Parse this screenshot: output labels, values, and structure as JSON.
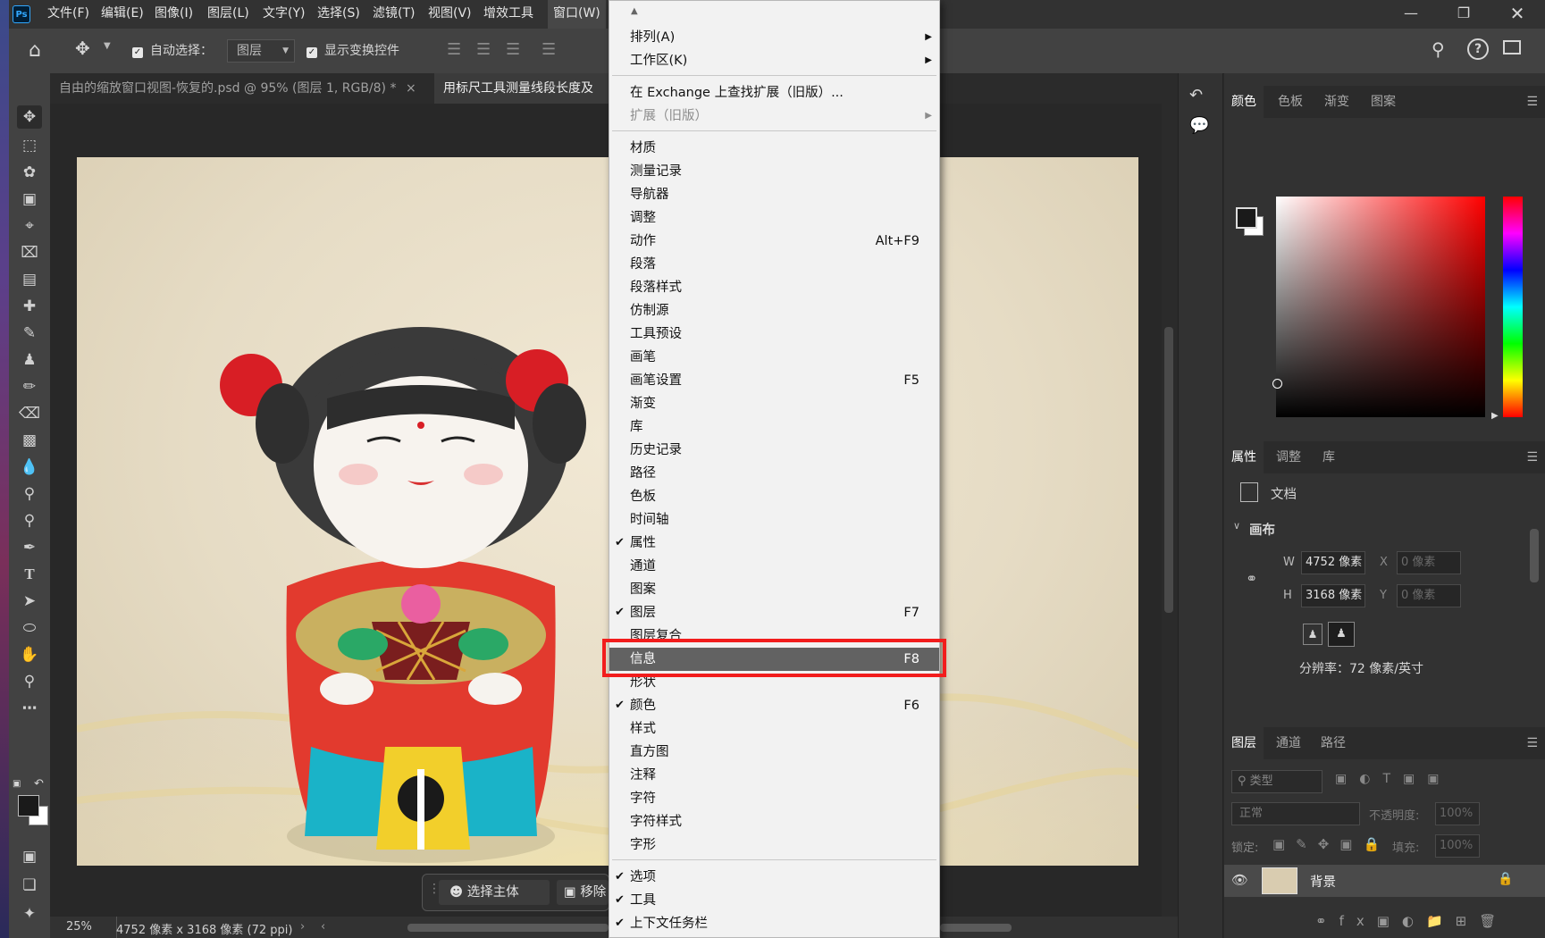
{
  "menubar": {
    "logo": "Ps",
    "items": [
      "文件(F)",
      "编辑(E)",
      "图像(I)",
      "图层(L)",
      "文字(Y)",
      "选择(S)",
      "滤镜(T)",
      "视图(V)",
      "增效工具",
      "窗口(W)"
    ],
    "window_buttons": [
      "minimize-icon",
      "restore-icon",
      "close-icon"
    ]
  },
  "options": {
    "auto_select_label": "自动选择：",
    "auto_select_value": "图层",
    "show_transform_label": "显示变换控件"
  },
  "tabs": [
    {
      "label": "自由的缩放窗口视图-恢复的.psd @ 95% (图层 1, RGB/8) *",
      "close": "×"
    },
    {
      "label": "用标尺工具测量线段长度及"
    }
  ],
  "context_bar": {
    "select_subject": "选择主体",
    "remove_bg": "移除"
  },
  "status": {
    "zoom": "25%",
    "doc_info": "4752 像素 x 3168 像素 (72 ppi)"
  },
  "panels": {
    "color_tabs": [
      "颜色",
      "色板",
      "渐变",
      "图案"
    ],
    "props_tabs": [
      "属性",
      "调整",
      "库"
    ],
    "doc_label": "文档",
    "canvas_section": "画布",
    "w_label": "W",
    "w_value": "4752 像素",
    "h_label": "H",
    "h_value": "3168 像素",
    "x_label": "X",
    "x_placeholder": "0 像素",
    "y_label": "Y",
    "y_placeholder": "0 像素",
    "resolution": "分辨率：72 像素/英寸",
    "layers_tabs": [
      "图层",
      "通道",
      "路径"
    ],
    "filter_placeholder": "类型",
    "blend_mode": "正常",
    "opacity_label": "不透明度:",
    "opacity_value": "100%",
    "lock_label": "锁定:",
    "fill_label": "填充:",
    "fill_value": "100%",
    "layer_name": "背景"
  },
  "window_menu": {
    "items": [
      {
        "label": "排列(A)",
        "submenu": true
      },
      {
        "label": "工作区(K)",
        "submenu": true
      },
      {
        "sep": true
      },
      {
        "label": "在 Exchange 上查找扩展（旧版）..."
      },
      {
        "label": "扩展（旧版）",
        "submenu": true,
        "disabled": true
      },
      {
        "sep": true
      },
      {
        "label": "材质"
      },
      {
        "label": "测量记录"
      },
      {
        "label": "导航器"
      },
      {
        "label": "调整"
      },
      {
        "label": "动作",
        "shortcut": "Alt+F9"
      },
      {
        "label": "段落"
      },
      {
        "label": "段落样式"
      },
      {
        "label": "仿制源"
      },
      {
        "label": "工具预设"
      },
      {
        "label": "画笔"
      },
      {
        "label": "画笔设置",
        "shortcut": "F5"
      },
      {
        "label": "渐变"
      },
      {
        "label": "库"
      },
      {
        "label": "历史记录"
      },
      {
        "label": "路径"
      },
      {
        "label": "色板"
      },
      {
        "label": "时间轴"
      },
      {
        "label": "属性",
        "checked": true
      },
      {
        "label": "通道"
      },
      {
        "label": "图案"
      },
      {
        "label": "图层",
        "checked": true,
        "shortcut": "F7"
      },
      {
        "label": "图层复合"
      },
      {
        "label": "信息",
        "shortcut": "F8",
        "highlighted": true
      },
      {
        "label": "形状"
      },
      {
        "label": "颜色",
        "checked": true,
        "shortcut": "F6"
      },
      {
        "label": "样式"
      },
      {
        "label": "直方图"
      },
      {
        "label": "注释"
      },
      {
        "label": "字符"
      },
      {
        "label": "字符样式"
      },
      {
        "label": "字形"
      },
      {
        "sep": true
      },
      {
        "label": "选项",
        "checked": true
      },
      {
        "label": "工具",
        "checked": true
      },
      {
        "label": "上下文任务栏",
        "checked": true
      }
    ]
  },
  "colors": {
    "highlight_border": "#f21d1d",
    "menu_hover": "#626262",
    "accent": "#31a8ff"
  }
}
